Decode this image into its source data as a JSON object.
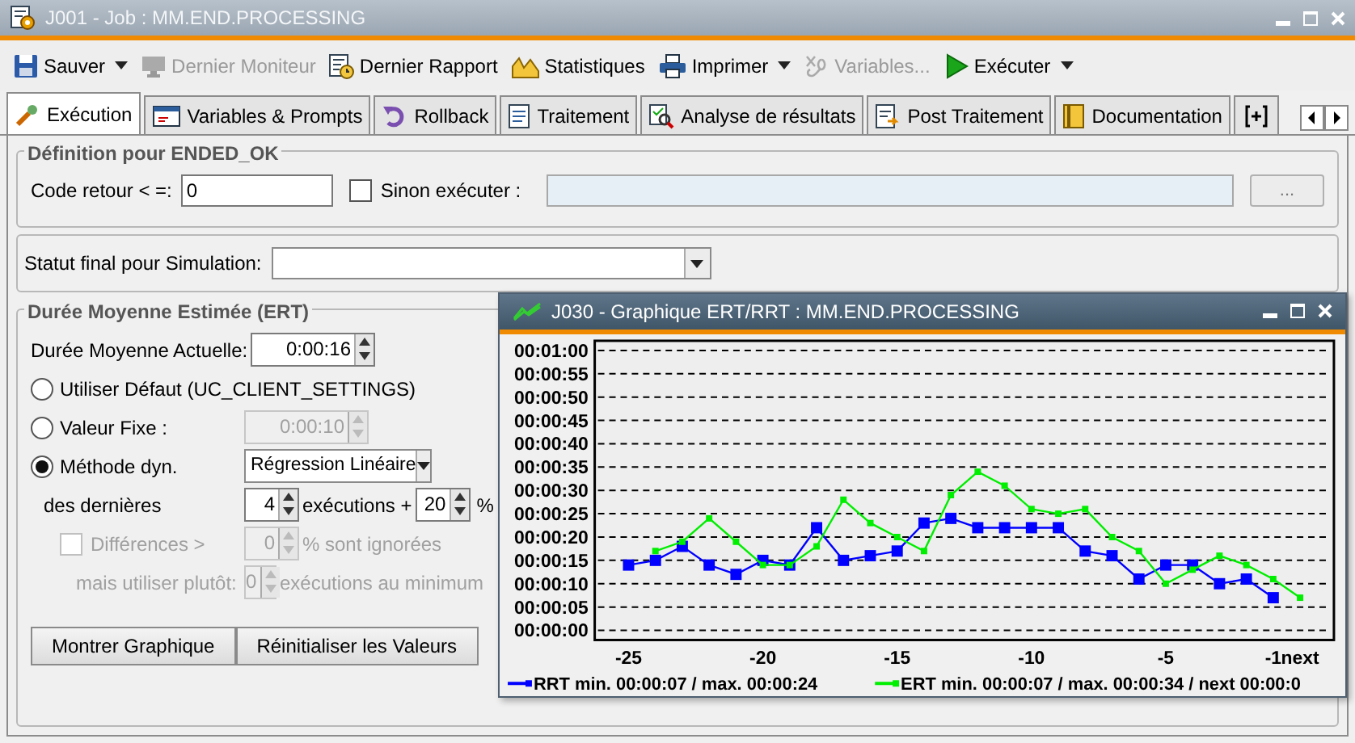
{
  "window": {
    "title": "J001 - Job : MM.END.PROCESSING"
  },
  "toolbar": [
    {
      "label": "Sauver",
      "disabled": false,
      "dropdown": true
    },
    {
      "label": "Dernier Moniteur",
      "disabled": true,
      "dropdown": false
    },
    {
      "label": "Dernier Rapport",
      "disabled": false,
      "dropdown": false
    },
    {
      "label": "Statistiques",
      "disabled": false,
      "dropdown": false
    },
    {
      "label": "Imprimer",
      "disabled": false,
      "dropdown": true
    },
    {
      "label": "Variables...",
      "disabled": true,
      "dropdown": false
    },
    {
      "label": "Exécuter",
      "disabled": false,
      "dropdown": true
    }
  ],
  "tabs": [
    {
      "label": "Exécution",
      "selected": true
    },
    {
      "label": "Variables & Prompts",
      "selected": false
    },
    {
      "label": "Rollback",
      "selected": false
    },
    {
      "label": "Traitement",
      "selected": false
    },
    {
      "label": "Analyse de résultats",
      "selected": false
    },
    {
      "label": "Post Traitement",
      "selected": false
    },
    {
      "label": "Documentation",
      "selected": false
    }
  ],
  "definition": {
    "title": "Définition pour ENDED_OK",
    "code_label": "Code retour < =:",
    "code_value": "0",
    "else_checkbox": {
      "label": "Sinon exécuter :",
      "checked": false
    },
    "browse_button": "..."
  },
  "simulation": {
    "label": "Statut final pour Simulation:"
  },
  "ert": {
    "title": "Durée Moyenne Estimée (ERT)",
    "current_label": "Durée Moyenne Actuelle:",
    "current_value": "0:00:16",
    "options": [
      {
        "kind": "plain",
        "label": "Utiliser Défaut (UC_CLIENT_SETTINGS)",
        "selected": false
      },
      {
        "kind": "time",
        "label": "Valeur Fixe :",
        "selected": false,
        "value": "0:00:10",
        "disabled": true
      },
      {
        "kind": "select",
        "label": "Méthode dyn.",
        "selected": true,
        "value": "Régression Linéaire"
      }
    ],
    "last_label": "des dernières",
    "last_count": "4",
    "last_suffix": "exécutions +",
    "percent": "20",
    "percent_suffix": "%",
    "differences": {
      "label": "Différences >",
      "checked": false,
      "disabled": true,
      "value": "0",
      "suffix": "% sont ignorées"
    },
    "fallback": {
      "label": "mais utiliser plutôt:",
      "value": "0",
      "suffix": "exécutions au minimum",
      "disabled": true
    },
    "buttons": [
      "Montrer Graphique",
      "Réinitialiser les Valeurs"
    ]
  },
  "chart_window": {
    "title": "J030 - Graphique ERT/RRT : MM.END.PROCESSING",
    "chart_data": {
      "type": "line",
      "x": [
        -25,
        -24,
        -23,
        -22,
        -21,
        -20,
        -19,
        -18,
        -17,
        -16,
        -15,
        -14,
        -13,
        -12,
        -11,
        -10,
        -9,
        -8,
        -7,
        -6,
        -5,
        -4,
        -3,
        -2,
        -1,
        0
      ],
      "xlim": [
        -26.26,
        1.26
      ],
      "ylim": [
        0,
        60
      ],
      "grid": true,
      "legend": true,
      "xticks": [
        {
          "value": -25,
          "label": "-25"
        },
        {
          "value": -20,
          "label": "-20"
        },
        {
          "value": -15,
          "label": "-15"
        },
        {
          "value": -10,
          "label": "-10"
        },
        {
          "value": -5,
          "label": "-5"
        },
        {
          "value": -1,
          "label": "-1"
        },
        {
          "value": 0,
          "label": "next"
        }
      ],
      "yticks": [
        {
          "value": 60,
          "label": "00:01:00"
        },
        {
          "value": 55,
          "label": "00:00:55"
        },
        {
          "value": 50,
          "label": "00:00:50"
        },
        {
          "value": 45,
          "label": "00:00:45"
        },
        {
          "value": 40,
          "label": "00:00:40"
        },
        {
          "value": 35,
          "label": "00:00:35"
        },
        {
          "value": 30,
          "label": "00:00:30"
        },
        {
          "value": 25,
          "label": "00:00:25"
        },
        {
          "value": 20,
          "label": "00:00:20"
        },
        {
          "value": 15,
          "label": "00:00:15"
        },
        {
          "value": 10,
          "label": "00:00:10"
        },
        {
          "value": 5,
          "label": "00:00:05"
        },
        {
          "value": 0,
          "label": "00:00:00"
        }
      ],
      "series": [
        {
          "name": "RRT min. 00:00:07 / max. 00:00:24",
          "color": "#0000ff",
          "marker": "square",
          "values": [
            14,
            15,
            18,
            14,
            12,
            15,
            14,
            22,
            15,
            16,
            17,
            23,
            24,
            22,
            22,
            22,
            22,
            17,
            16,
            11,
            14,
            14,
            10,
            11,
            7,
            null
          ]
        },
        {
          "name": "ERT min. 00:00:07 / max. 00:00:34 / next 00:00:0",
          "color": "#00ee00",
          "marker": "square",
          "values": [
            null,
            17,
            19,
            24,
            19,
            14,
            14,
            18,
            28,
            23,
            20,
            17,
            29,
            34,
            31,
            26,
            25,
            26,
            20,
            17,
            10,
            13,
            16,
            14,
            11,
            7
          ]
        }
      ]
    }
  }
}
